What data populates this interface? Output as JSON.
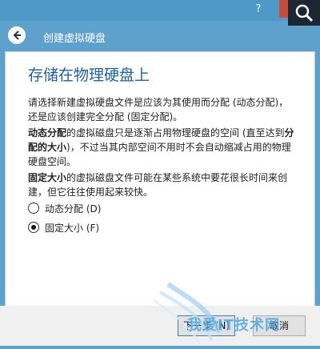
{
  "window": {
    "title": "创建虚拟硬盘",
    "help_label": "?",
    "close_label": "✕"
  },
  "page": {
    "heading": "存储在物理硬盘上",
    "intro": "请选择新建虚拟硬盘文件是应该为其使用而分配 (动态分配)，还是应该创建完全分配 (固定分配)。",
    "dynamic": {
      "bold": "动态分配",
      "text_a": "的虚拟磁盘只是逐渐占用物理硬盘的空间 (直至达到",
      "bold_b": "分配的大小",
      "text_b": ")，不过当其内部空间不用时不会自动缩减占用的物理硬盘空间。"
    },
    "fixed": {
      "bold": "固定大小",
      "text": "的虚拟磁盘文件可能在某些系统中要花很长时间来创建，但它往往使用起来较快。"
    }
  },
  "options": [
    {
      "label": "动态分配 (D)",
      "checked": false
    },
    {
      "label": "固定大小 (F)",
      "checked": true
    }
  ],
  "footer": {
    "next_label": "下一步 (N)",
    "cancel_label": "取消"
  },
  "watermark": {
    "text": "我爱IT技术网"
  }
}
